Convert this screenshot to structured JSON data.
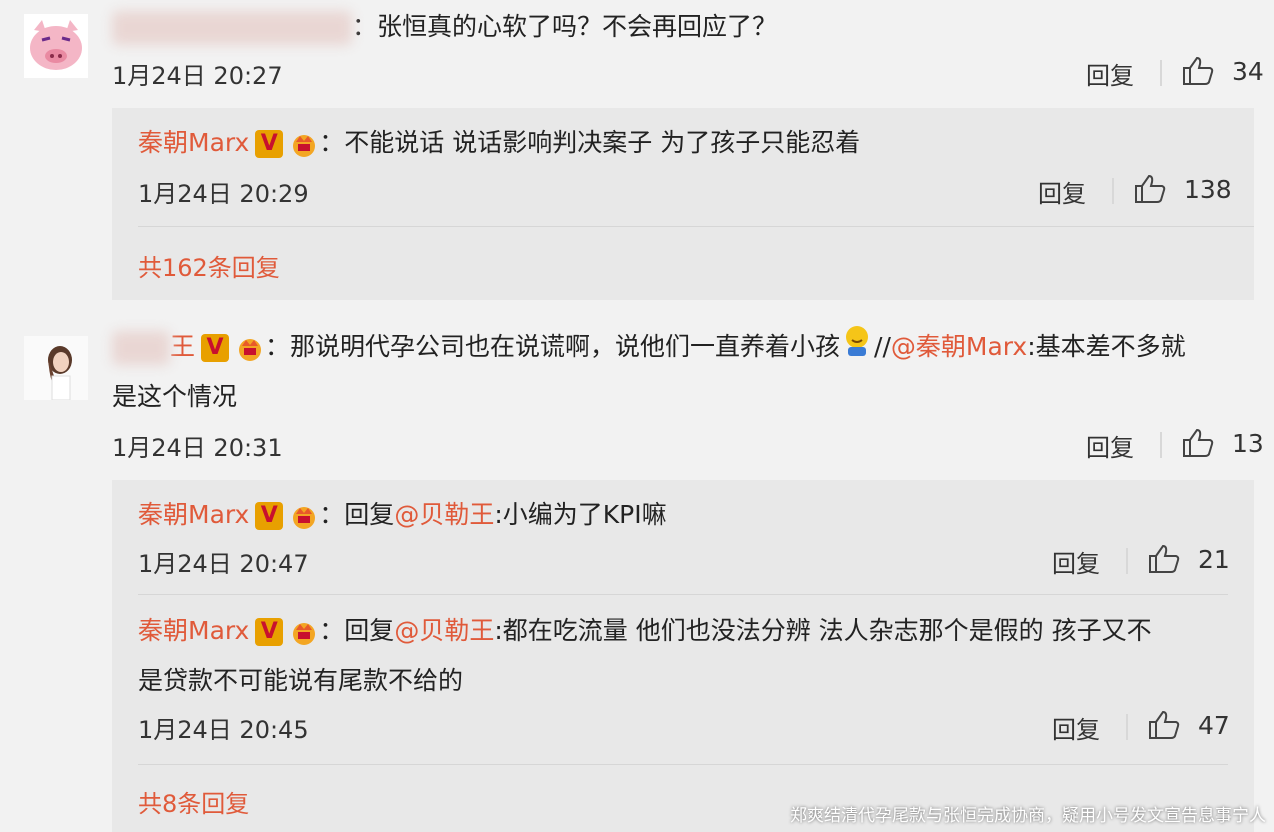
{
  "comments": [
    {
      "text": "：张恒真的心软了吗？不会再回应了？",
      "date": "1月24日 20:27",
      "reply_label": "回复",
      "likes": "34",
      "replies": [
        {
          "user": "秦朝Marx",
          "text": "：不能说话 说话影响判决案子 为了孩子只能忍着",
          "date": "1月24日 20:29",
          "reply_label": "回复",
          "likes": "138"
        }
      ],
      "more": "共162条回复"
    },
    {
      "user_suffix": "王",
      "text_a": "：那说明代孕公司也在说谎啊，说他们一直养着小孩",
      "text_b": "//",
      "mention": "@秦朝Marx",
      "text_c": ":基本差不多就",
      "text_d": "是这个情况",
      "date": "1月24日 20:31",
      "reply_label": "回复",
      "likes": "13",
      "replies": [
        {
          "user": "秦朝Marx",
          "prefix": "：回复",
          "mention": "@贝勒王",
          "text": ":小编为了KPI嘛",
          "date": "1月24日 20:47",
          "reply_label": "回复",
          "likes": "21"
        },
        {
          "user": "秦朝Marx",
          "prefix": "：回复",
          "mention": "@贝勒王",
          "text": ":都在吃流量 他们也没法分辨 法人杂志那个是假的 孩子又不",
          "text_2": "是贷款不可能说有尾款不给的",
          "date": "1月24日 20:45",
          "reply_label": "回复",
          "likes": "47"
        }
      ],
      "more": "共8条回复"
    }
  ],
  "badges": {
    "v": "V"
  },
  "caption": "郑爽结清代孕尾款与张恒完成协商，疑用小号发文宣告息事宁人",
  "colors": {
    "accent": "#e05a3a",
    "badge_bg": "#e8a000",
    "badge_v": "#c8102e"
  }
}
